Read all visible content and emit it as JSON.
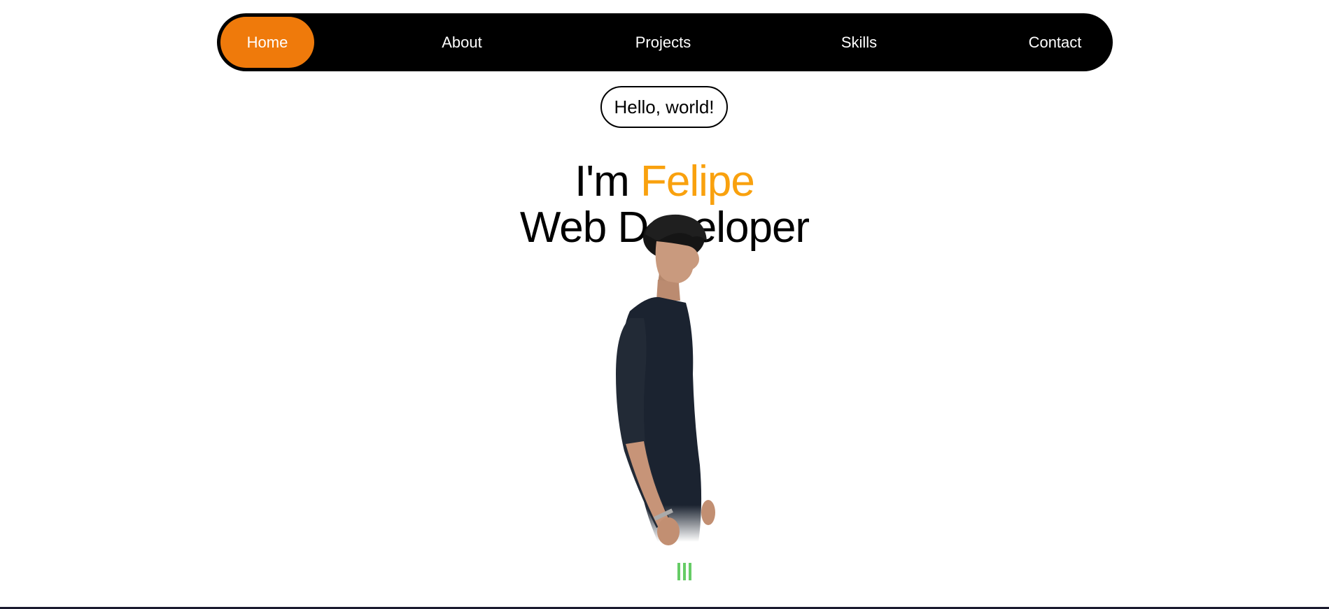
{
  "nav": {
    "items": [
      {
        "label": "Home",
        "active": true
      },
      {
        "label": "About",
        "active": false
      },
      {
        "label": "Projects",
        "active": false
      },
      {
        "label": "Skills",
        "active": false
      },
      {
        "label": "Contact",
        "active": false
      }
    ]
  },
  "hero": {
    "greeting": "Hello, world!",
    "intro_prefix": "I'm",
    "name": "Felipe",
    "role": "Web Developer"
  },
  "colors": {
    "accent": "#ef7a0b",
    "name_highlight": "#f9a10e",
    "nav_background": "#000000"
  }
}
